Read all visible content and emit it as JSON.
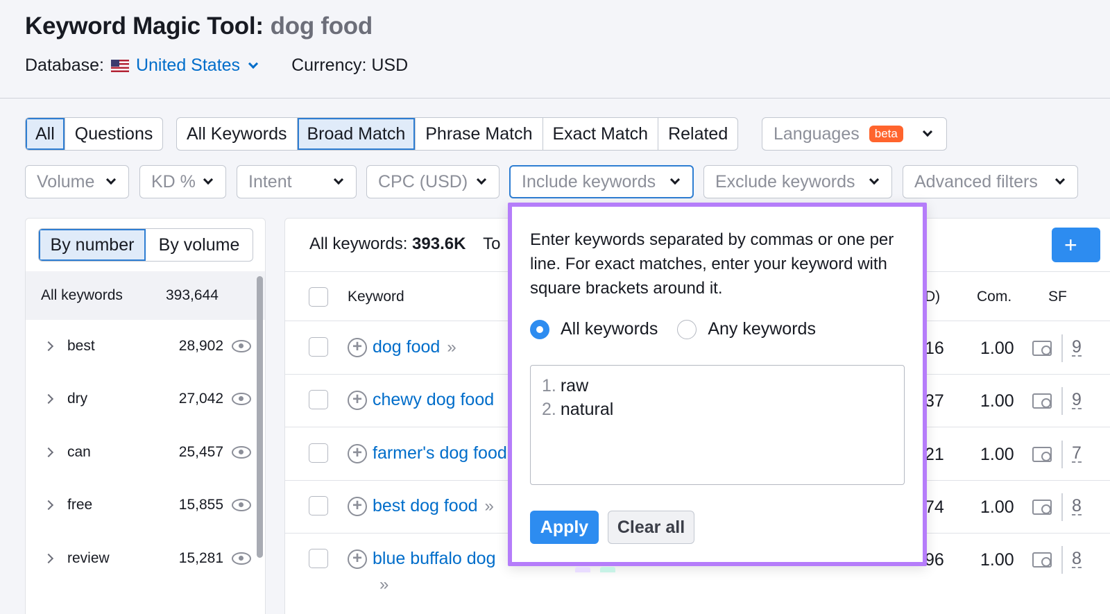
{
  "header": {
    "title": "Keyword Magic Tool:",
    "query": "dog food",
    "database_label": "Database:",
    "database_value": "United States",
    "currency": "Currency: USD"
  },
  "tabs_primary": [
    {
      "label": "All",
      "active": true
    },
    {
      "label": "Questions",
      "active": false
    }
  ],
  "tabs_match": [
    {
      "label": "All Keywords",
      "active": false
    },
    {
      "label": "Broad Match",
      "active": true
    },
    {
      "label": "Phrase Match",
      "active": false
    },
    {
      "label": "Exact Match",
      "active": false
    },
    {
      "label": "Related",
      "active": false
    }
  ],
  "languages": {
    "label": "Languages",
    "badge": "beta"
  },
  "filters": [
    {
      "label": "Volume"
    },
    {
      "label": "KD %"
    },
    {
      "label": "Intent"
    },
    {
      "label": "CPC (USD)"
    },
    {
      "label": "Include keywords"
    },
    {
      "label": "Exclude keywords"
    },
    {
      "label": "Advanced filters"
    }
  ],
  "sidebar": {
    "segments": [
      "By number",
      "By volume"
    ],
    "all_label": "All keywords",
    "all_count": "393,644",
    "groups": [
      {
        "label": "best",
        "count": "28,902"
      },
      {
        "label": "dry",
        "count": "27,042"
      },
      {
        "label": "can",
        "count": "25,457"
      },
      {
        "label": "free",
        "count": "15,855"
      },
      {
        "label": "review",
        "count": "15,281"
      }
    ]
  },
  "table": {
    "summary_label": "All keywords:",
    "summary_value": "393.6K",
    "summary_cut": "To",
    "columns": {
      "keyword": "Keyword",
      "cpc": "D)",
      "com": "Com.",
      "sf": "SF"
    },
    "add_button": "+",
    "rows": [
      {
        "keyword": "dog food",
        "arrows": "»",
        "cpc": "16",
        "com": "1.00",
        "sf": "9"
      },
      {
        "keyword": "chewy dog food",
        "arrows": "",
        "cpc": "37",
        "com": "1.00",
        "sf": "9"
      },
      {
        "keyword": "farmer's dog food",
        "arrows": "",
        "cpc": "21",
        "com": "1.00",
        "sf": "7"
      },
      {
        "keyword": "best dog food",
        "arrows": "»",
        "cpc": "74",
        "com": "1.00",
        "sf": "8"
      },
      {
        "keyword": "blue buffalo dog",
        "arrows": "",
        "cpc": "96",
        "com": "1.00",
        "sf": "8"
      }
    ],
    "wrap_arrows": "»"
  },
  "popover": {
    "instructions": "Enter keywords separated by commas or one per line. For exact matches, enter your keyword with square brackets around it.",
    "radio_all": "All keywords",
    "radio_any": "Any keywords",
    "lines": [
      {
        "num": "1.",
        "text": "raw"
      },
      {
        "num": "2.",
        "text": "natural"
      }
    ],
    "apply": "Apply",
    "clear": "Clear all"
  },
  "colors": {
    "accent": "#2d8cf0",
    "highlight": "#b57dfa",
    "link": "#006dca",
    "beta": "#ff642d"
  }
}
